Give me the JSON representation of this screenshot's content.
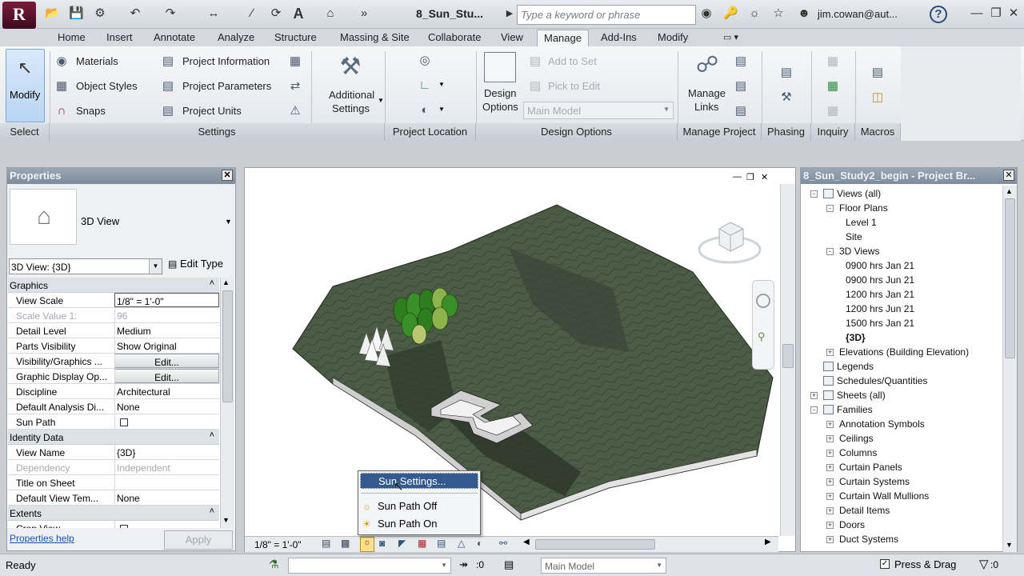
{
  "app": {
    "logo": "R",
    "doc_title": "8_Sun_Stu...",
    "search_placeholder": "Type a keyword or phrase",
    "user": "jim.cowan@aut..."
  },
  "tabs": [
    "Home",
    "Insert",
    "Annotate",
    "Analyze",
    "Structure",
    "Massing & Site",
    "Collaborate",
    "View",
    "Manage",
    "Add-Ins",
    "Modify"
  ],
  "active_tab": "Manage",
  "ribbon": {
    "modify": "Modify",
    "select": "Select",
    "settings_left": [
      "Materials",
      "Object Styles",
      "Snaps"
    ],
    "settings_mid": [
      "Project Information",
      "Project Parameters",
      "Project Units"
    ],
    "additional_settings": [
      "Additional",
      "Settings"
    ],
    "settings_title": "Settings",
    "project_location_title": "Project Location",
    "design_options": {
      "btn1": "Design",
      "btn2": "Options",
      "add_to_set": "Add to Set",
      "pick_to_edit": "Pick to Edit",
      "main_model": "Main Model",
      "title": "Design Options"
    },
    "manage_project": {
      "btn1": "Manage",
      "btn2": "Links",
      "title": "Manage Project"
    },
    "phasing": "Phasing",
    "inquiry": "Inquiry",
    "macros": "Macros"
  },
  "properties": {
    "title": "Properties",
    "type_name": "3D View",
    "selector": "3D View: {3D}",
    "edit_type": "Edit Type",
    "rows": [
      {
        "kind": "cat",
        "label": "Graphics"
      },
      {
        "kind": "row",
        "k": "View Scale",
        "v": "1/8\" = 1'-0\""
      },
      {
        "kind": "gray",
        "k": "Scale Value    1:",
        "v": "96"
      },
      {
        "kind": "row",
        "k": "Detail Level",
        "v": "Medium"
      },
      {
        "kind": "row",
        "k": "Parts Visibility",
        "v": "Show Original"
      },
      {
        "kind": "btn",
        "k": "Visibility/Graphics ...",
        "v": "Edit..."
      },
      {
        "kind": "btn",
        "k": "Graphic Display Op...",
        "v": "Edit..."
      },
      {
        "kind": "row",
        "k": "Discipline",
        "v": "Architectural"
      },
      {
        "kind": "row",
        "k": "Default Analysis Di...",
        "v": "None"
      },
      {
        "kind": "chk",
        "k": "Sun Path",
        "v": ""
      },
      {
        "kind": "cat",
        "label": "Identity Data"
      },
      {
        "kind": "row",
        "k": "View Name",
        "v": "{3D}"
      },
      {
        "kind": "gray",
        "k": "Dependency",
        "v": "Independent"
      },
      {
        "kind": "row",
        "k": "Title on Sheet",
        "v": ""
      },
      {
        "kind": "row",
        "k": "Default View Tem...",
        "v": "None"
      },
      {
        "kind": "cat",
        "label": "Extents"
      },
      {
        "kind": "chk",
        "k": "Crop View",
        "v": ""
      }
    ],
    "help": "Properties help",
    "apply": "Apply"
  },
  "viewcontrol": {
    "scale": "1/8\" = 1'-0\""
  },
  "popup": {
    "items": [
      "Sun Settings...",
      "Sun Path Off",
      "Sun Path On"
    ]
  },
  "browser": {
    "title": "8_Sun_Study2_begin - Project Br...",
    "nodes": [
      {
        "t": "Views (all)",
        "lvl": 0,
        "pm": "-",
        "ico": true
      },
      {
        "t": "Floor Plans",
        "lvl": 1,
        "pm": "-"
      },
      {
        "t": "Level 1",
        "lvl": 2
      },
      {
        "t": "Site",
        "lvl": 2
      },
      {
        "t": "3D Views",
        "lvl": 1,
        "pm": "-"
      },
      {
        "t": "0900 hrs Jan 21",
        "lvl": 2
      },
      {
        "t": "0900 hrs Jun 21",
        "lvl": 2
      },
      {
        "t": "1200 hrs Jan 21",
        "lvl": 2
      },
      {
        "t": "1200 hrs Jun 21",
        "lvl": 2
      },
      {
        "t": "1500 hrs Jan 21",
        "lvl": 2
      },
      {
        "t": "{3D}",
        "lvl": 2,
        "bold": true
      },
      {
        "t": "Elevations (Building Elevation)",
        "lvl": 1,
        "pm": "+"
      },
      {
        "t": "Legends",
        "lvl": 0,
        "ico": true
      },
      {
        "t": "Schedules/Quantities",
        "lvl": 0,
        "ico": true
      },
      {
        "t": "Sheets (all)",
        "lvl": 0,
        "pm": "+",
        "ico": true
      },
      {
        "t": "Families",
        "lvl": 0,
        "pm": "-",
        "ico": true
      },
      {
        "t": "Annotation Symbols",
        "lvl": 1,
        "pm": "+"
      },
      {
        "t": "Ceilings",
        "lvl": 1,
        "pm": "+"
      },
      {
        "t": "Columns",
        "lvl": 1,
        "pm": "+"
      },
      {
        "t": "Curtain Panels",
        "lvl": 1,
        "pm": "+"
      },
      {
        "t": "Curtain Systems",
        "lvl": 1,
        "pm": "+"
      },
      {
        "t": "Curtain Wall Mullions",
        "lvl": 1,
        "pm": "+"
      },
      {
        "t": "Detail Items",
        "lvl": 1,
        "pm": "+"
      },
      {
        "t": "Doors",
        "lvl": 1,
        "pm": "+"
      },
      {
        "t": "Duct Systems",
        "lvl": 1,
        "pm": "+"
      }
    ]
  },
  "status": {
    "text": "Ready",
    "count": ":0",
    "model": "Main Model",
    "press_drag": "Press & Drag",
    "filter": ":0"
  }
}
